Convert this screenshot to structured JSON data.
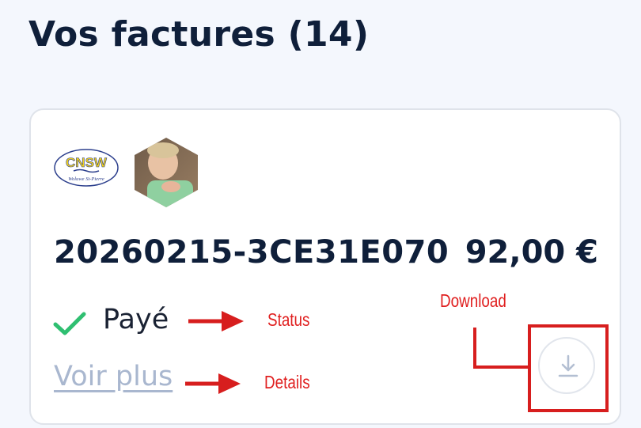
{
  "header": {
    "title": "Vos factures (14)"
  },
  "invoice": {
    "number": "20260215-3CE31E070",
    "amount": "92,00 €",
    "status": "Payé",
    "details_link": "Voir plus",
    "club_logo": {
      "line1": "CNSW",
      "line2": "Woluwe St-Pierre"
    }
  },
  "annotations": {
    "status": "Status",
    "details": "Details",
    "download": "Download"
  },
  "colors": {
    "annotation": "#e02020",
    "check": "#2fbf71",
    "link": "#a9b7cf",
    "text": "#0f1f3a"
  },
  "icons": {
    "status": "check-icon",
    "download": "download-icon",
    "arrow": "arrow-right-icon"
  }
}
